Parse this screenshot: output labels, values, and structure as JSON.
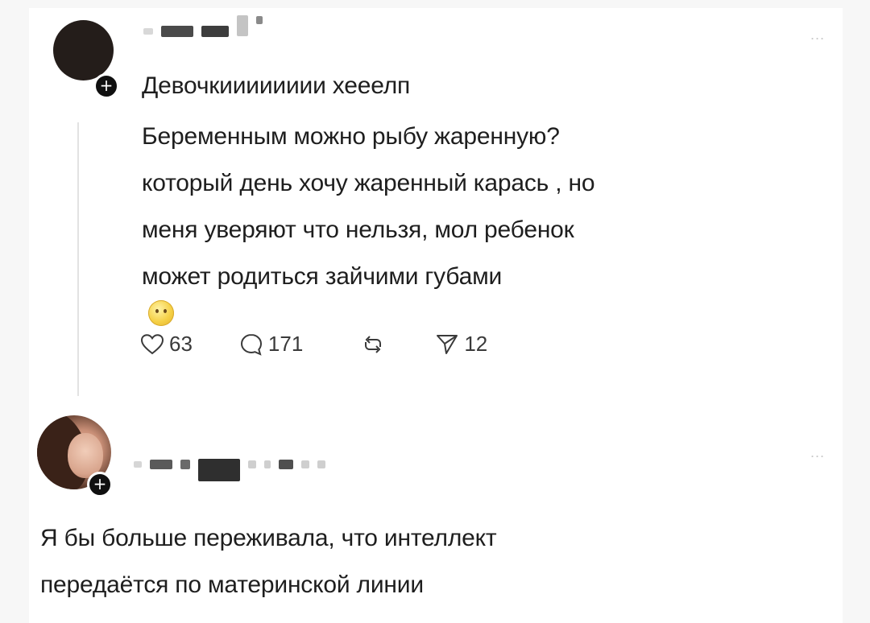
{
  "colors": {
    "text": "#1e1e1e",
    "muted": "#3a3a3a",
    "avatar_dark": "#241d1a",
    "badge": "#101010",
    "redacted": "#4a4a4a"
  },
  "post1": {
    "avatar": "avatar-dark-circle",
    "follow_badge": "+",
    "more_menu": "...",
    "title": "Девочкииииииии хееелп",
    "body_lines": [
      "Беременным можно рыбу жаренную?",
      "который день хочу жаренный карась , но",
      "меня уверяют что нельзя, мол ребенок",
      "может родиться зайчими губами"
    ],
    "emoji": "face-holding-back-tears",
    "actions": {
      "likes": "63",
      "comments": "171",
      "reposts": "",
      "shares": "12"
    }
  },
  "post2": {
    "avatar": "woman-photo",
    "follow_badge": "+",
    "more_menu": "...",
    "body_lines": [
      "Я бы больше переживала, что интеллект",
      "передаётся по материнской линии"
    ]
  }
}
